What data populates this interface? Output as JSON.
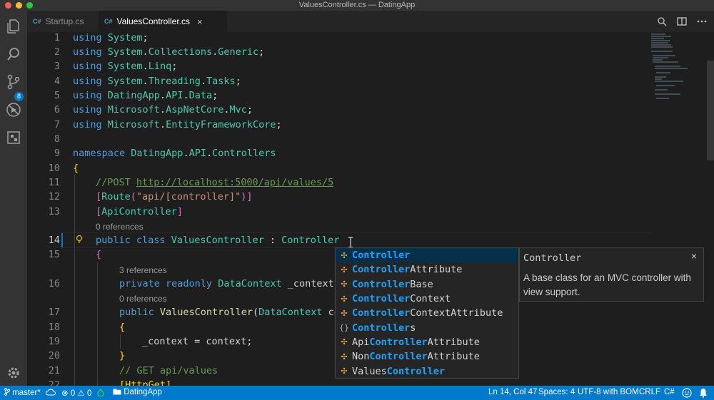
{
  "window": {
    "title": "ValuesController.cs — DatingApp"
  },
  "activity_bar": {
    "items": [
      {
        "name": "explorer",
        "icon": "files-icon"
      },
      {
        "name": "search",
        "icon": "search-icon"
      },
      {
        "name": "source-control",
        "icon": "source-control-icon",
        "badge": "8"
      },
      {
        "name": "debug",
        "icon": "debug-icon"
      },
      {
        "name": "extensions",
        "icon": "extensions-icon"
      }
    ],
    "settings_icon": "gear-icon"
  },
  "tabs": [
    {
      "lang": "C#",
      "label": "Startup.cs",
      "active": false
    },
    {
      "lang": "C#",
      "label": "ValuesController.cs",
      "active": true,
      "close": "×"
    }
  ],
  "editor": {
    "line_numbers": [
      "1",
      "2",
      "3",
      "4",
      "5",
      "6",
      "7",
      "8",
      "9",
      "10",
      "11",
      "12",
      "13",
      "14",
      "15",
      "16",
      "17",
      "18",
      "19",
      "20",
      "21",
      "22"
    ],
    "code_lens": {
      "class_refs": "0 references",
      "field_refs": "3 references",
      "ctor_refs": "0 references"
    },
    "lines": {
      "l1": [
        "using",
        " System",
        ";"
      ],
      "l2": [
        "using",
        " System",
        ".",
        "Collections",
        ".",
        "Generic",
        ";"
      ],
      "l3": [
        "using",
        " System",
        ".",
        "Linq",
        ";"
      ],
      "l4": [
        "using",
        " System",
        ".",
        "Threading",
        ".",
        "Tasks",
        ";"
      ],
      "l5": [
        "using",
        " DatingApp",
        ".",
        "API",
        ".",
        "Data",
        ";"
      ],
      "l6": [
        "using",
        " Microsoft",
        ".",
        "AspNetCore",
        ".",
        "Mvc",
        ";"
      ],
      "l7": [
        "using",
        " Microsoft",
        ".",
        "EntityFrameworkCore",
        ";"
      ],
      "l9": [
        "namespace",
        " DatingApp",
        ".",
        "API",
        ".",
        "Controllers"
      ],
      "l10": "{",
      "l11": [
        "//POST ",
        "http://localhost:5000/api/values/5"
      ],
      "l12": [
        "[",
        "Route",
        "(",
        "\"api/[controller]\"",
        ")",
        "]"
      ],
      "l13": [
        "[",
        "ApiController",
        "]"
      ],
      "l14": [
        "public",
        " class",
        " ValuesController",
        " : ",
        "Controller"
      ],
      "l15": "{",
      "l16": [
        "private",
        " readonly",
        " DataContext",
        " _context;"
      ],
      "l17": [
        "public",
        " ValuesController",
        "(",
        "DataContext",
        " co"
      ],
      "l18": "{",
      "l19": "_context = context;",
      "l20": "}",
      "l21": "// GET api/values",
      "l22": "[HttpGet]"
    }
  },
  "suggest": {
    "items": [
      {
        "kind": "class",
        "icon": "class-icon",
        "pre": "",
        "match": "Controller",
        "post": "",
        "selected": true
      },
      {
        "kind": "class",
        "icon": "class-icon",
        "pre": "",
        "match": "Controller",
        "post": "Attribute"
      },
      {
        "kind": "class",
        "icon": "class-icon",
        "pre": "",
        "match": "Controller",
        "post": "Base"
      },
      {
        "kind": "class",
        "icon": "class-icon",
        "pre": "",
        "match": "Controller",
        "post": "Context"
      },
      {
        "kind": "class",
        "icon": "class-icon",
        "pre": "",
        "match": "Controller",
        "post": "ContextAttribute"
      },
      {
        "kind": "namespace",
        "icon": "namespace-icon",
        "pre": "",
        "match": "Controller",
        "post": "s"
      },
      {
        "kind": "class",
        "icon": "class-icon",
        "pre": "Api",
        "match": "Controller",
        "post": "Attribute"
      },
      {
        "kind": "class",
        "icon": "class-icon",
        "pre": "Non",
        "match": "Controller",
        "post": "Attribute"
      },
      {
        "kind": "class",
        "icon": "class-icon",
        "pre": "Values",
        "match": "Controller",
        "post": ""
      }
    ],
    "detail": {
      "title": "Controller",
      "close": "×",
      "doc": "A base class for an MVC controller with view support."
    }
  },
  "status_bar": {
    "branch": "master*",
    "errors": "0",
    "warnings": "0",
    "folder": "DatingApp",
    "position": "Ln 14, Col 47",
    "spaces": "Spaces: 4",
    "encoding": "UTF-8 with BOM",
    "eol": "CRLF",
    "language": "C#"
  },
  "colors": {
    "accent": "#007acc",
    "keyword": "#569cd6",
    "type": "#4ec9b0",
    "comment": "#6a9955",
    "string": "#ce9178",
    "match_highlight": "#18a3ff"
  }
}
